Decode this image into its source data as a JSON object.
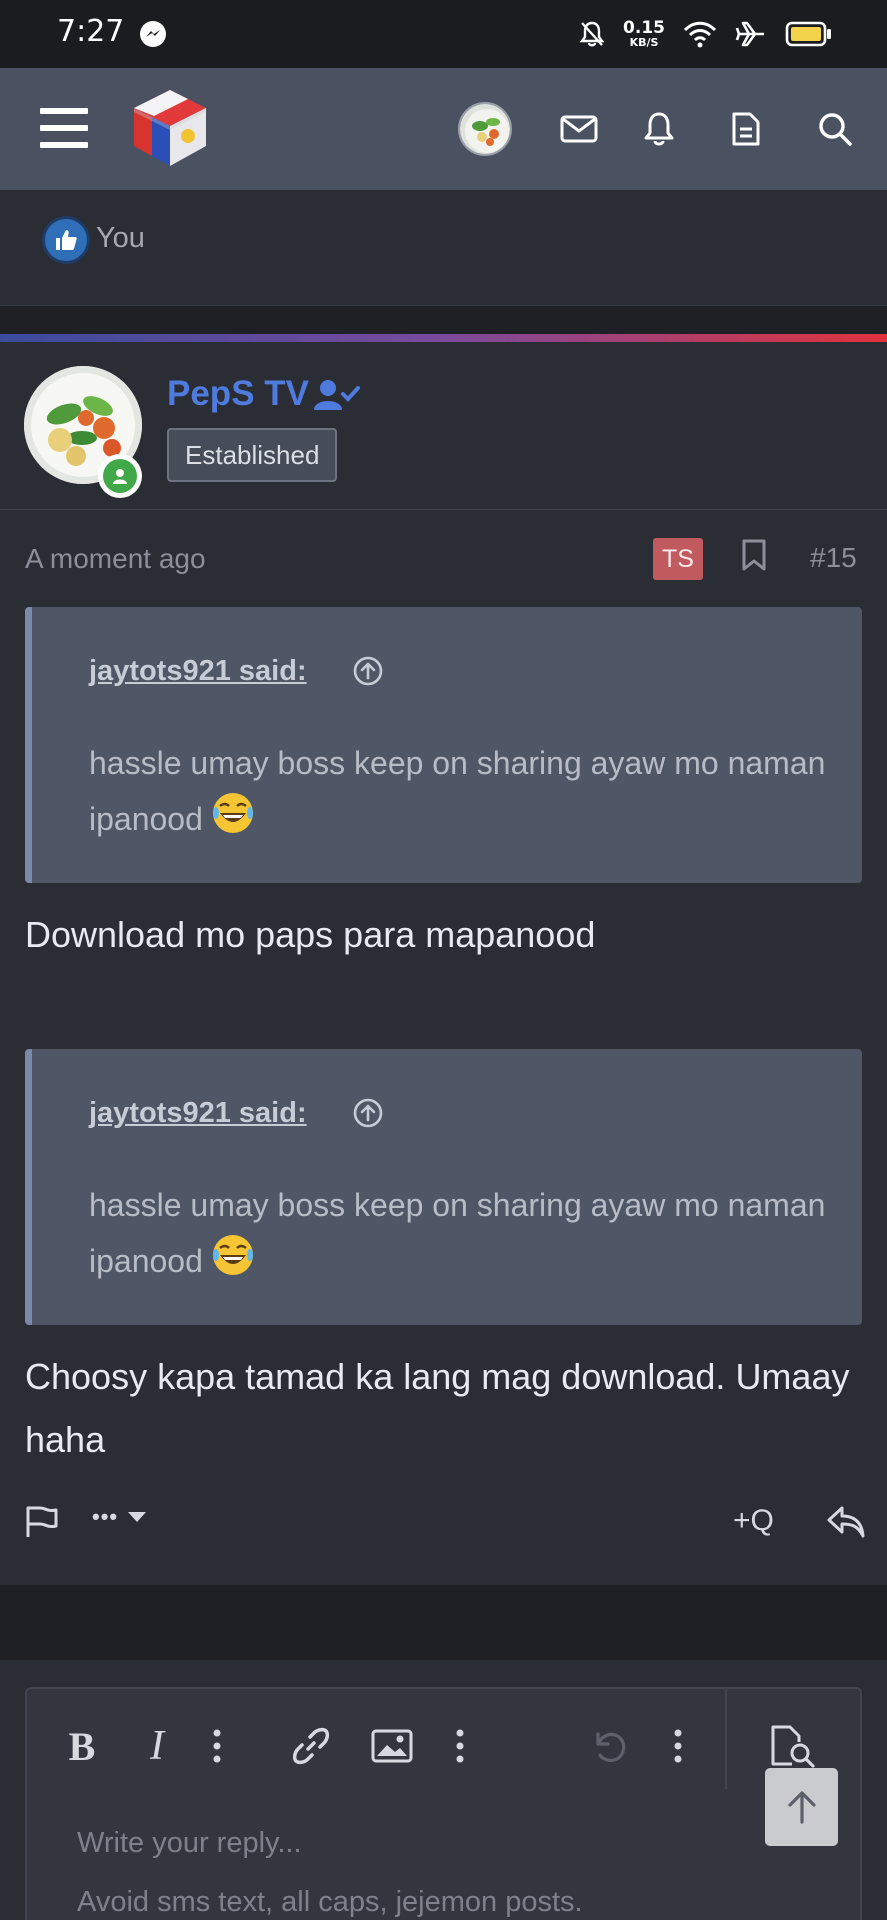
{
  "status_bar": {
    "time": "7:27",
    "net_speed_value": "0.15",
    "net_speed_unit": "KB/S"
  },
  "reactions": {
    "text": "You"
  },
  "post": {
    "author": "PepS TV",
    "user_title": "Established",
    "time": "A moment ago",
    "ts_badge": "TS",
    "number": "#15",
    "quotes": [
      {
        "author": "jaytots921 said:",
        "text": "hassle umay boss keep on sharing ayaw mo naman ipanood"
      },
      {
        "author": "jaytots921 said:",
        "text": "hassle umay boss keep on sharing ayaw mo naman ipanood"
      }
    ],
    "replies": [
      "Download mo paps para mapanood",
      "Choosy kapa tamad ka lang mag download. Umaay haha"
    ],
    "actions": {
      "more": "•••",
      "multi_quote": "+Q"
    }
  },
  "editor": {
    "bold": "B",
    "italic": "I",
    "placeholder": "Write your reply...",
    "hint": "Avoid sms text, all caps, jejemon posts."
  },
  "colors": {
    "nav_bg": "#4a5160",
    "page_bg": "#2b2d35",
    "accent": "#4f7bde",
    "ts_badge": "#c05a5e",
    "quote_bg": "#4f5666"
  }
}
